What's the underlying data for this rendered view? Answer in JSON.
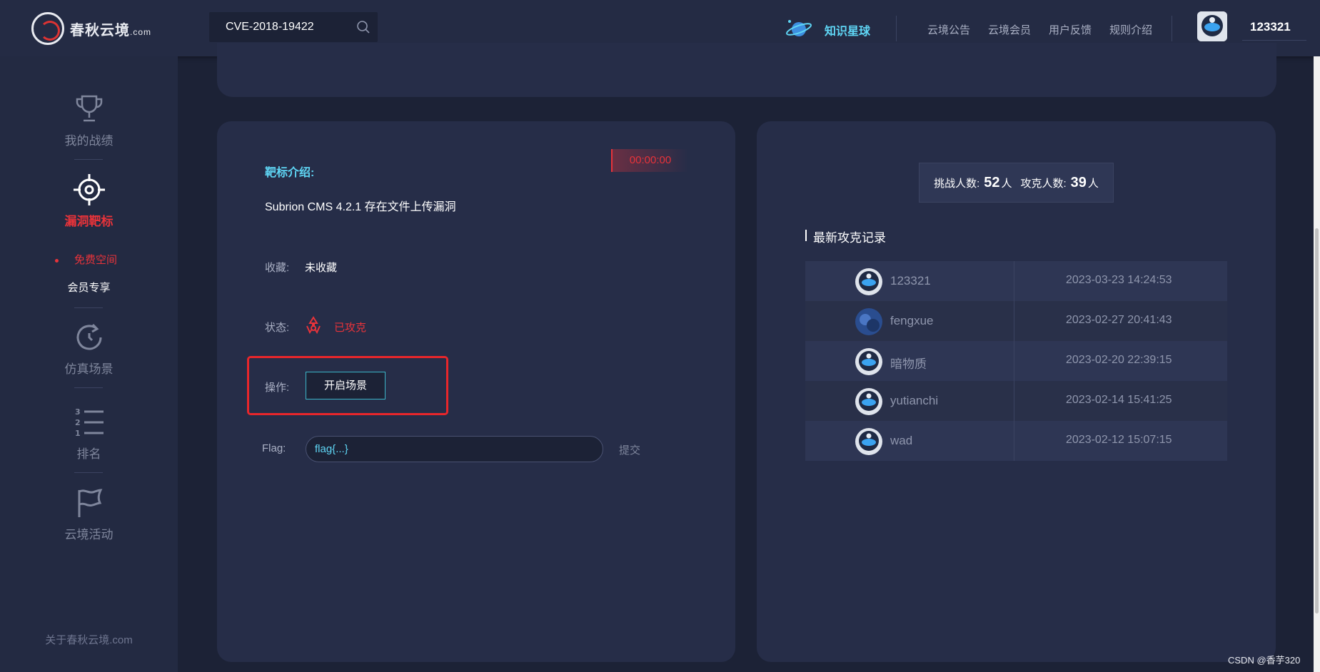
{
  "header": {
    "logo_text": "春秋云境",
    "logo_suffix": ".com",
    "search_value": "CVE-2018-19422",
    "planet_label": "知识星球",
    "nav": [
      "云境公告",
      "云境会员",
      "用户反馈",
      "规则介绍"
    ],
    "username": "123321"
  },
  "sidebar": {
    "items": [
      {
        "label": "我的战绩",
        "icon": "trophy-icon"
      },
      {
        "label": "漏洞靶标",
        "icon": "target-icon"
      },
      {
        "label": "仿真场景",
        "icon": "refresh-icon"
      },
      {
        "label": "排名",
        "icon": "ranking-list-icon"
      },
      {
        "label": "云境活动",
        "icon": "flag-icon"
      }
    ],
    "sub_items": [
      "免费空间",
      "会员专享"
    ],
    "about": "关于春秋云境.com"
  },
  "target": {
    "timer": "00:00:00",
    "intro_label": "靶标介绍:",
    "intro_text": "Subrion CMS 4.2.1 存在文件上传漏洞",
    "favorite_label": "收藏:",
    "favorite_value": "未收藏",
    "status_label": "状态:",
    "status_value": "已攻克",
    "action_label": "操作:",
    "start_button": "开启场景",
    "flag_label": "Flag:",
    "flag_placeholder": "flag{...}",
    "submit_label": "提交"
  },
  "stats": {
    "challengers_label": "挑战人数:",
    "challengers_value": "52",
    "solvers_label": "攻克人数:",
    "solvers_value": "39",
    "unit": "人"
  },
  "records": {
    "title": "最新攻克记录",
    "rows": [
      {
        "name": "123321",
        "time": "2023-03-23 14:24:53"
      },
      {
        "name": "fengxue",
        "time": "2023-02-27 20:41:43"
      },
      {
        "name": "暗物质",
        "time": "2023-02-20 22:39:15"
      },
      {
        "name": "yutianchi",
        "time": "2023-02-14 15:41:25"
      },
      {
        "name": "wad",
        "time": "2023-02-12 15:07:15"
      }
    ]
  },
  "watermark": "CSDN @香芋320",
  "colors": {
    "accent_red": "#e8333a",
    "accent_cyan": "#5fd6f5",
    "panel": "#262d48",
    "bg": "#1c2236"
  }
}
